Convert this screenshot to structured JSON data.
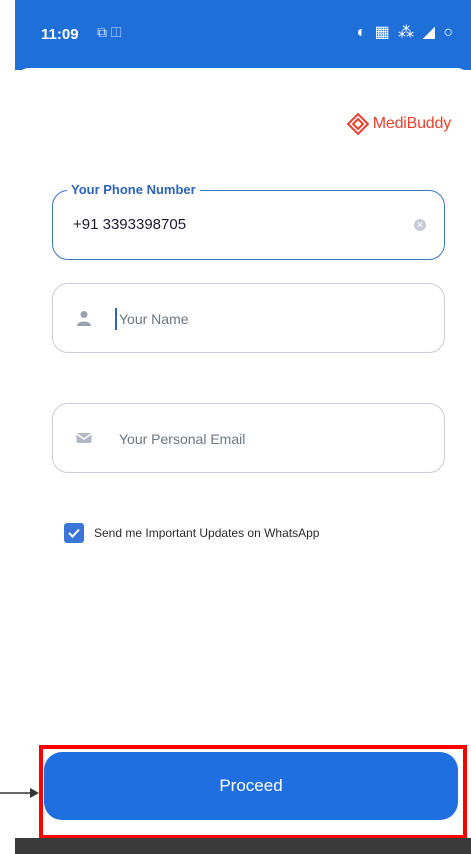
{
  "status_bar": {
    "time": "11:09",
    "left_icons": "⧉ ◫",
    "right_icons": "◐ ▦ ⁂ ◢ ○"
  },
  "logo": {
    "brand": "MediBuddy",
    "brand_color": "#e8422e"
  },
  "form": {
    "phone": {
      "label": "Your Phone Number",
      "value": "+91 3393398705"
    },
    "name": {
      "placeholder": "Your Name"
    },
    "email": {
      "placeholder": "Your Personal Email"
    },
    "whatsapp": {
      "label": "Send me Important Updates on WhatsApp",
      "checked": true
    }
  },
  "actions": {
    "proceed_label": "Proceed"
  },
  "colors": {
    "primary": "#1f6fe0",
    "highlight": "#ff0000"
  }
}
